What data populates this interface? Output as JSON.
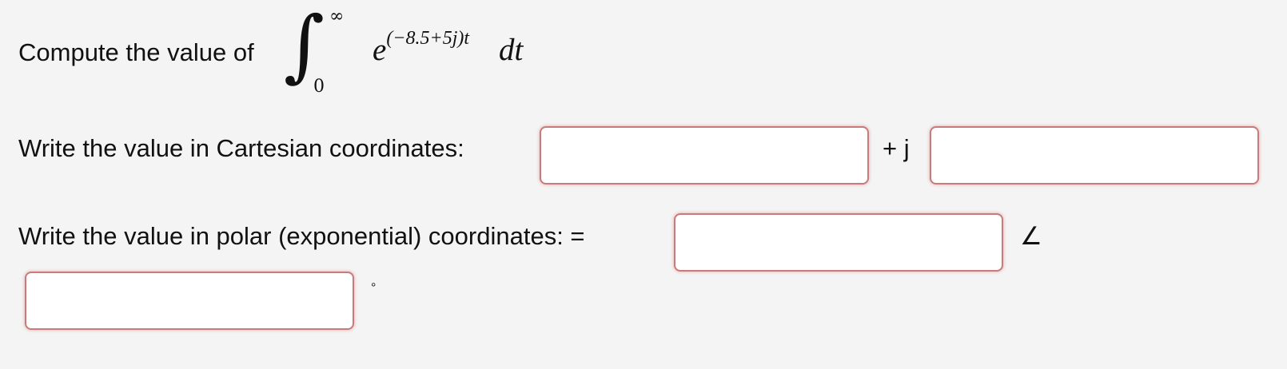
{
  "question": {
    "prompt": "Compute the value of",
    "integral": {
      "lower_limit": "0",
      "upper_limit": "∞",
      "base": "e",
      "exponent": "(−8.5+5j)t",
      "differential": "dt"
    }
  },
  "cartesian": {
    "label": "Write the value in Cartesian coordinates:",
    "real_value": "",
    "imag_symbol": "+ j",
    "imag_value": ""
  },
  "polar": {
    "label": "Write the value in polar (exponential) coordinates: =",
    "magnitude_value": "",
    "angle_symbol": "∠",
    "angle_value": "",
    "degree_symbol": "°"
  }
}
